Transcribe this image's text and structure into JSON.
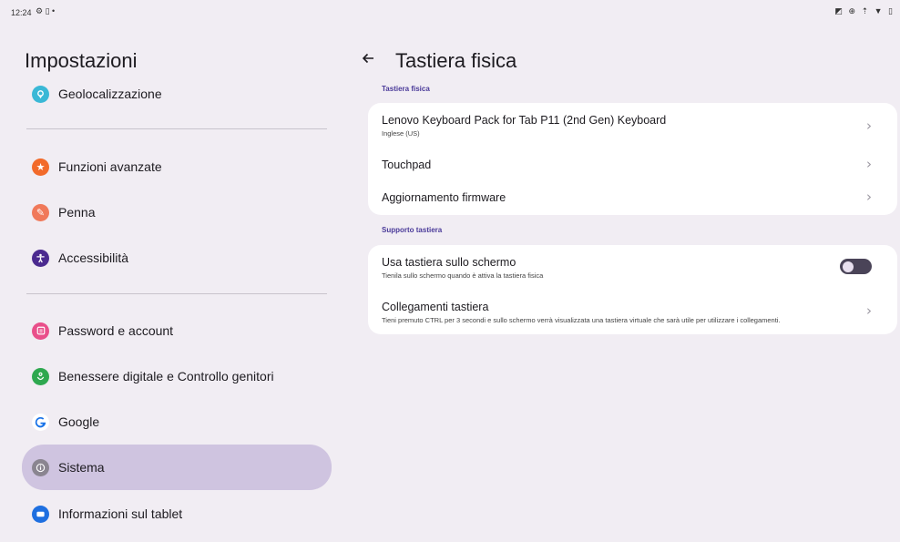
{
  "status_bar": {
    "time": "12:24",
    "left_icons": "⚙ ▯ •",
    "right_icons": "◩ ⊕ ⇡ ▼ ▯"
  },
  "left_panel": {
    "title": "Impostazioni",
    "items": [
      {
        "label": "Geolocalizzazione",
        "icon": "location-icon",
        "color": "#3ab8d6",
        "glyph": "⊙"
      },
      {
        "label": "Funzioni avanzate",
        "icon": "star-icon",
        "color": "#f26a2a",
        "glyph": "★"
      },
      {
        "label": "Penna",
        "icon": "pen-icon",
        "color": "#f0795a",
        "glyph": "✎"
      },
      {
        "label": "Accessibilità",
        "icon": "accessibility-icon",
        "color": "#4b2a8f",
        "glyph": "✦"
      },
      {
        "label": "Password e account",
        "icon": "key-icon",
        "color": "#e94f8a",
        "glyph": "▣"
      },
      {
        "label": "Benessere digitale e Controllo genitori",
        "icon": "wellbeing-icon",
        "color": "#2ea84f",
        "glyph": "♡"
      },
      {
        "label": "Google",
        "icon": "google-icon",
        "color": "#ffffff",
        "glyph": "G"
      },
      {
        "label": "Sistema",
        "icon": "info-icon",
        "color": "#8a8590",
        "glyph": "ⓘ"
      },
      {
        "label": "Informazioni sul tablet",
        "icon": "tablet-icon",
        "color": "#1e6fe0",
        "glyph": "▬"
      }
    ]
  },
  "right_panel": {
    "title": "Tastiera fisica",
    "section1": "Tastiera fisica",
    "keyboard_name": "Lenovo Keyboard Pack for Tab P11 (2nd Gen) Keyboard",
    "keyboard_sub": "Inglese (US)",
    "touchpad": "Touchpad",
    "firmware": "Aggiornamento firmware",
    "section2": "Supporto tastiera",
    "onscreen_title": "Usa tastiera sullo schermo",
    "onscreen_sub": "Tienila sullo schermo quando è attiva la tastiera fisica",
    "onscreen_enabled": false,
    "shortcuts_title": "Collegamenti tastiera",
    "shortcuts_sub": "Tieni premuto CTRL per 3 secondi e sullo schermo verrà visualizzata una tastiera virtuale che sarà utile per utilizzare i collegamenti."
  },
  "colors": {
    "background": "#f1edf3",
    "selected_nav": "#cfc4e0",
    "section_header": "#4a3a99",
    "toggle_off": "#4a4458"
  }
}
